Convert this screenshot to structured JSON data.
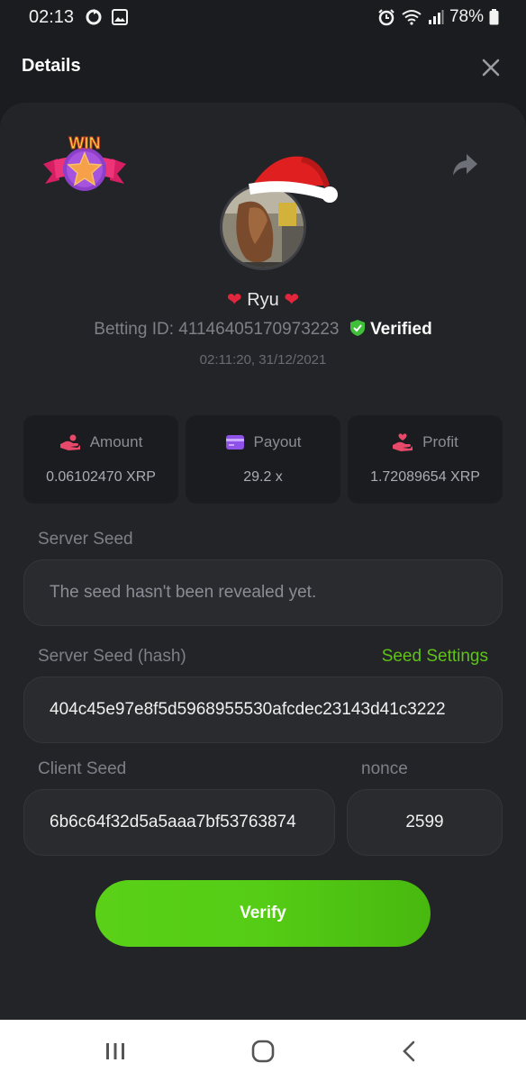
{
  "status_bar": {
    "time": "02:13",
    "battery": "78%"
  },
  "header": {
    "title": "Details"
  },
  "user": {
    "name": "Ryu",
    "betting_id_label": "Betting ID: 41146405170973223",
    "verified_label": "Verified",
    "timestamp": "02:11:20, 31/12/2021"
  },
  "badge": {
    "text": "WIN"
  },
  "stats": [
    {
      "label": "Amount",
      "value": "0.06102470 XRP",
      "icon": "hand-coin-icon",
      "color": "#e8486a"
    },
    {
      "label": "Payout",
      "value": "29.2 x",
      "icon": "wallet-card-icon",
      "color": "#8f52e8"
    },
    {
      "label": "Profit",
      "value": "1.72089654 XRP",
      "icon": "hand-heart-icon",
      "color": "#e8486a"
    }
  ],
  "server_seed": {
    "label": "Server Seed",
    "value": "The seed hasn't been revealed yet."
  },
  "server_seed_hash": {
    "label": "Server Seed (hash)",
    "link": "Seed Settings",
    "value": "404c45e97e8f5d5968955530afcdec23143d41c3222"
  },
  "client_seed": {
    "label": "Client Seed",
    "value": "6b6c64f32d5a5aaa7bf53763874"
  },
  "nonce": {
    "label": "nonce",
    "value": "2599"
  },
  "verify_button": {
    "label": "Verify"
  },
  "colors": {
    "accent_green": "#5fc317",
    "background": "#1b1c1f",
    "card": "#232427"
  }
}
